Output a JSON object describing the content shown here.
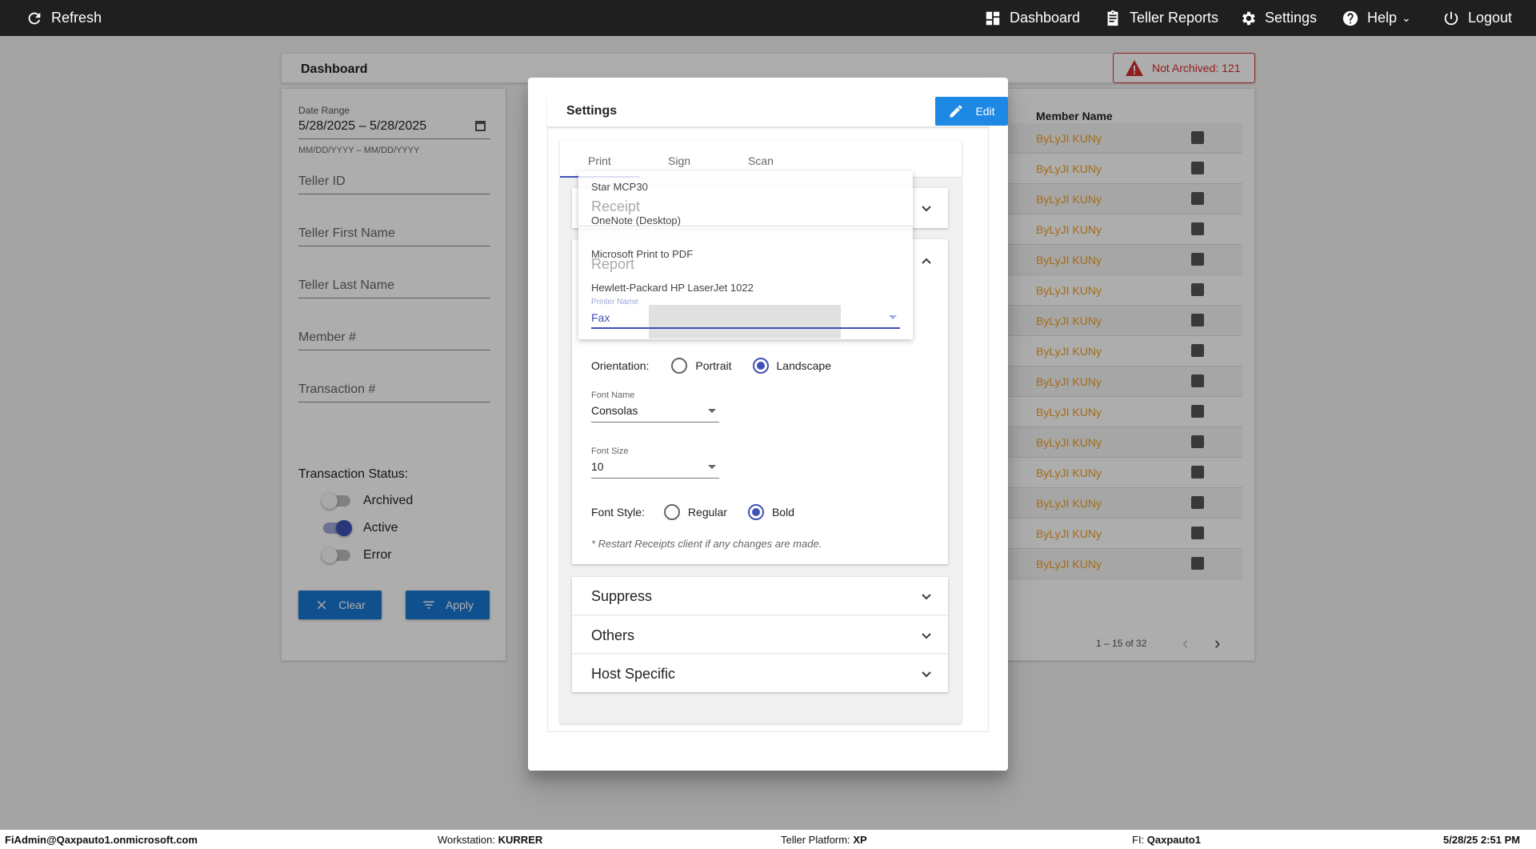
{
  "topbar": {
    "refresh": "Refresh",
    "dashboard": "Dashboard",
    "teller_reports": "Teller Reports",
    "settings": "Settings",
    "help": "Help",
    "logout": "Logout"
  },
  "dashboard": {
    "title": "Dashboard",
    "not_archived": "Not Archived: 121"
  },
  "filter": {
    "date_range_label": "Date Range",
    "date_range_value": "5/28/2025 – 5/28/2025",
    "date_hint": "MM/DD/YYYY – MM/DD/YYYY",
    "teller_id": "Teller ID",
    "teller_first_name": "Teller First Name",
    "teller_last_name": "Teller Last Name",
    "member_no": "Member #",
    "transaction_no": "Transaction #",
    "status_label": "Transaction Status:",
    "statuses": [
      {
        "label": "Archived",
        "on": false
      },
      {
        "label": "Active",
        "on": true
      },
      {
        "label": "Error",
        "on": false
      }
    ],
    "clear": "Clear",
    "apply": "Apply"
  },
  "table": {
    "header": "Member Name",
    "rows": [
      "ByLyJI KUNy",
      "ByLyJI KUNy",
      "ByLyJI KUNy",
      "ByLyJI KUNy",
      "ByLyJI KUNy",
      "ByLyJI KUNy",
      "ByLyJI KUNy",
      "ByLyJI KUNy",
      "ByLyJI KUNy",
      "ByLyJI KUNy",
      "ByLyJI KUNy",
      "ByLyJI KUNy",
      "ByLyJI KUNy",
      "ByLyJI KUNy",
      "ByLyJI KUNy"
    ],
    "pagination": "1 – 15 of 32"
  },
  "settings_dialog": {
    "title": "Settings",
    "edit": "Edit",
    "tabs": [
      "Print",
      "Sign",
      "Scan"
    ],
    "receipt_ghost": "Receipt",
    "report_ghost": "Report",
    "printer_options": [
      "Star MCP30",
      "OneNote (Desktop)",
      "Microsoft Print to PDF",
      "Hewlett-Packard HP LaserJet 1022"
    ],
    "printer_label": "Printer Name",
    "printer_value": "Fax",
    "orientation_label": "Orientation:",
    "orientation_portrait": "Portrait",
    "orientation_landscape": "Landscape",
    "font_name_label": "Font Name",
    "font_name_value": "Consolas",
    "font_size_label": "Font Size",
    "font_size_value": "10",
    "font_style_label": "Font Style:",
    "font_style_regular": "Regular",
    "font_style_bold": "Bold",
    "restart_note": "* Restart Receipts client if any changes are made.",
    "sections": [
      "Suppress",
      "Others",
      "Host Specific"
    ]
  },
  "statusbar": {
    "user": "FiAdmin@Qaxpauto1.onmicrosoft.com",
    "workstation_label": "Workstation:",
    "workstation_value": "KURRER",
    "platform_label": "Teller Platform:",
    "platform_value": "XP",
    "fi_label": "FI:",
    "fi_value": "Qaxpauto1",
    "datetime": "5/28/25 2:51 PM"
  }
}
